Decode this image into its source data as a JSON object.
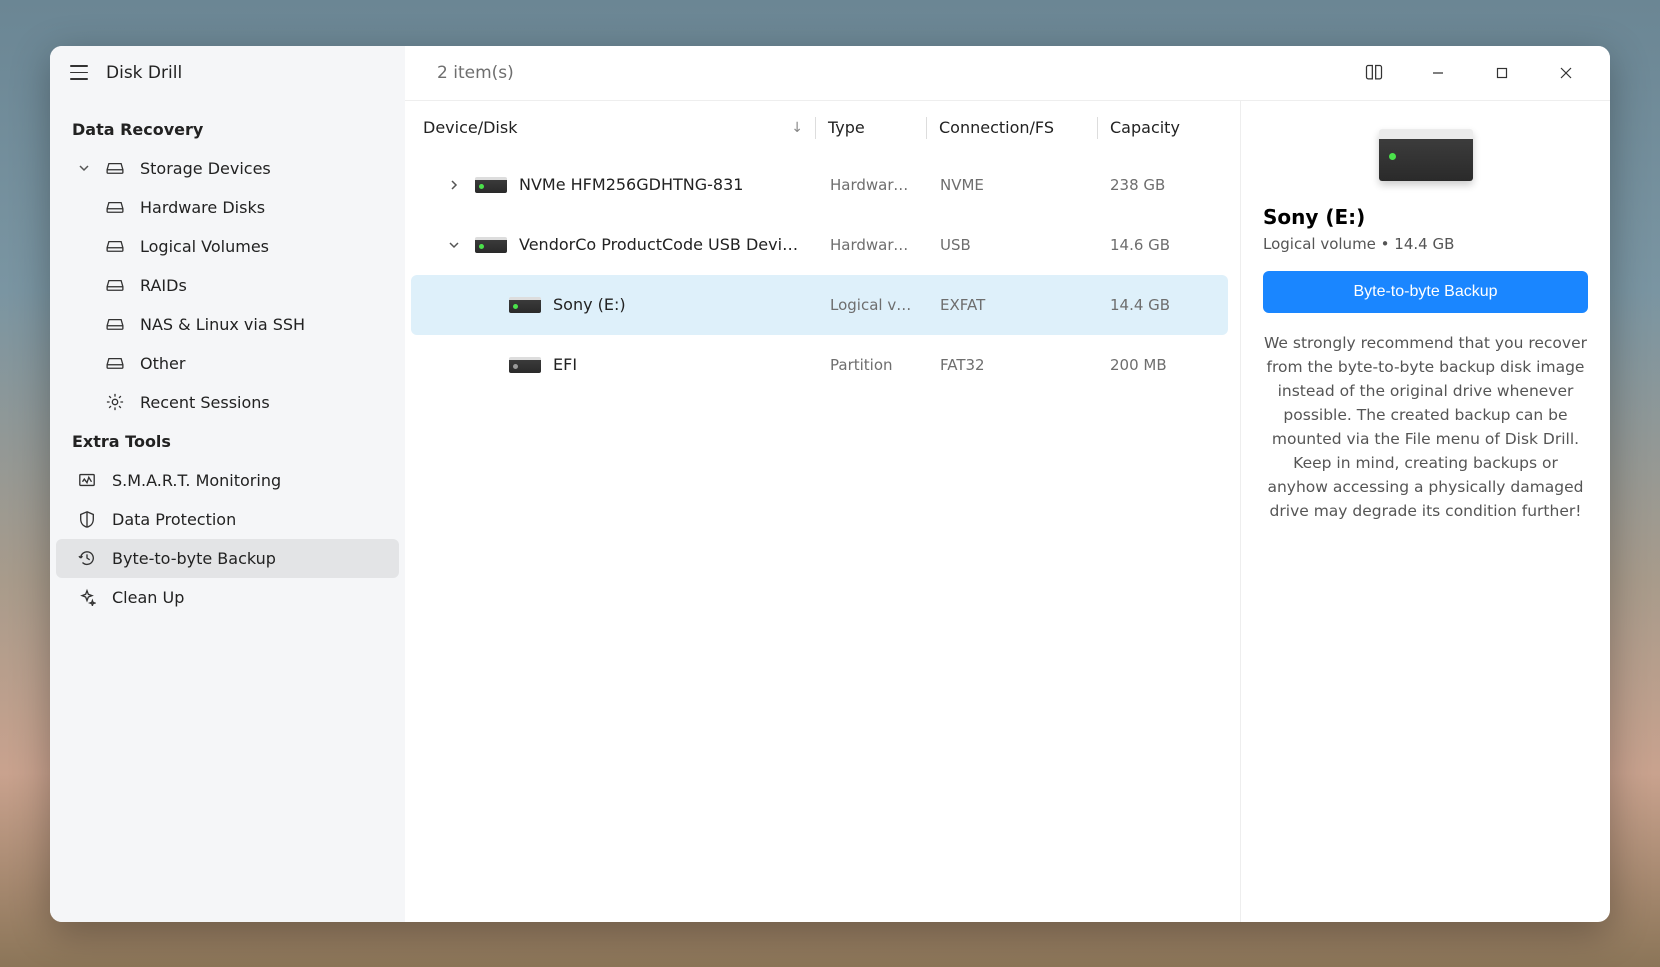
{
  "app_title": "Disk Drill",
  "item_count": "2 item(s)",
  "sidebar": {
    "sections": [
      {
        "title": "Data Recovery",
        "items": [
          {
            "label": "Storage Devices",
            "expandable": true,
            "expanded": true,
            "icon": "drive"
          },
          {
            "label": "Hardware Disks",
            "indent": 2,
            "icon": "drive"
          },
          {
            "label": "Logical Volumes",
            "indent": 2,
            "icon": "drive"
          },
          {
            "label": "RAIDs",
            "indent": 2,
            "icon": "drive"
          },
          {
            "label": "NAS & Linux via SSH",
            "indent": 2,
            "icon": "drive"
          },
          {
            "label": "Other",
            "indent": 2,
            "icon": "drive"
          },
          {
            "label": "Recent Sessions",
            "indent": 1,
            "icon": "gear"
          }
        ]
      },
      {
        "title": "Extra Tools",
        "items": [
          {
            "label": "S.M.A.R.T. Monitoring",
            "indent": 1,
            "icon": "smart"
          },
          {
            "label": "Data Protection",
            "indent": 1,
            "icon": "shield"
          },
          {
            "label": "Byte-to-byte Backup",
            "indent": 1,
            "icon": "history",
            "selected": true
          },
          {
            "label": "Clean Up",
            "indent": 1,
            "icon": "sparkle"
          }
        ]
      }
    ]
  },
  "columns": {
    "device": "Device/Disk",
    "type": "Type",
    "conn": "Connection/FS",
    "cap": "Capacity"
  },
  "rows": [
    {
      "device": "NVMe HFM256GDHTNG-831",
      "type": "Hardware…",
      "conn": "NVME",
      "cap": "238 GB",
      "expand": "right",
      "indent": 1,
      "green": true
    },
    {
      "device": "VendorCo ProductCode USB Devi…",
      "type": "Hardware…",
      "conn": "USB",
      "cap": "14.6 GB",
      "expand": "down",
      "indent": 1,
      "green": true
    },
    {
      "device": "Sony (E:)",
      "type": "Logical vol…",
      "conn": "EXFAT",
      "cap": "14.4 GB",
      "indent": 2,
      "selected": true,
      "green": true
    },
    {
      "device": "EFI",
      "type": "Partition",
      "conn": "FAT32",
      "cap": "200 MB",
      "indent": 2,
      "gray": true
    }
  ],
  "details": {
    "title": "Sony (E:)",
    "subtitle": "Logical volume • 14.4 GB",
    "button": "Byte-to-byte Backup",
    "text": "We strongly recommend that you recover from the byte-to-byte backup disk image instead of the original drive whenever possible. The created backup can be mounted via the File menu of Disk Drill. Keep in mind, creating backups or anyhow accessing a physically damaged drive may degrade its condition further!"
  }
}
